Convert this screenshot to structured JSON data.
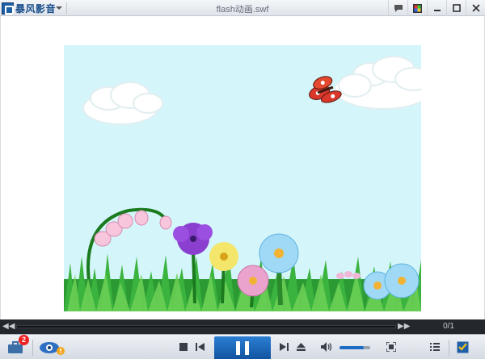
{
  "app": {
    "logo_text": "暴风影音",
    "window_title": "flash动画.swf"
  },
  "window_buttons": [
    "chat-icon",
    "skin-icon",
    "minimize-icon",
    "maximize-icon",
    "close-icon"
  ],
  "player": {
    "playlist_count": "0/1",
    "notification_badge": "2",
    "volume_level": 0.8,
    "state": "playing"
  },
  "colors": {
    "accent": "#1f6cc5",
    "sky": "#d4f6fb",
    "seekbar_bg": "#24272c"
  }
}
